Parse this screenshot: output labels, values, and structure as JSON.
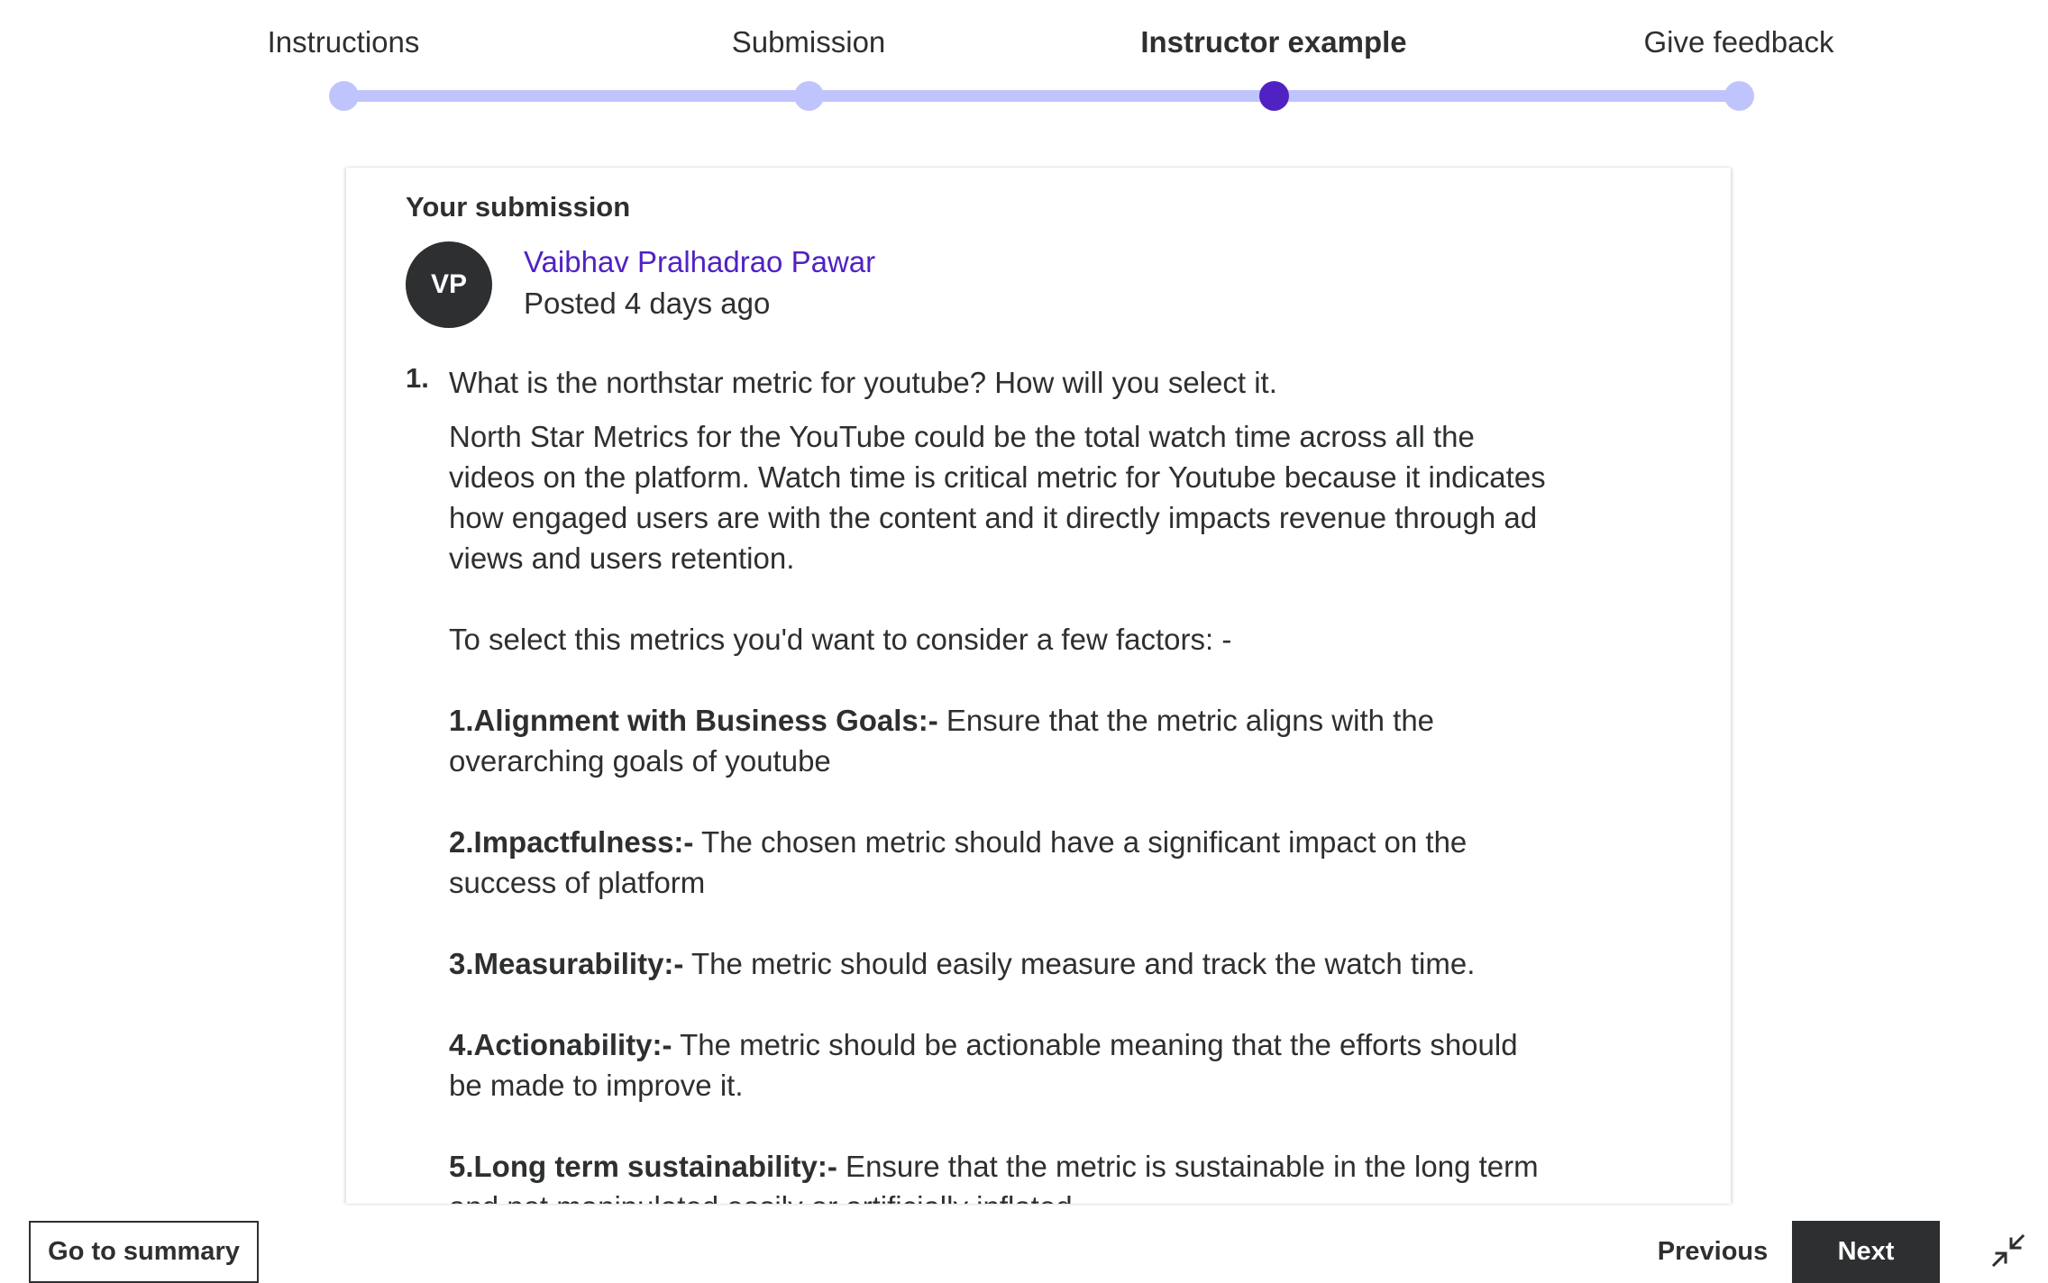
{
  "stepper": {
    "steps": [
      {
        "label": "Instructions",
        "state": "done"
      },
      {
        "label": "Submission",
        "state": "done"
      },
      {
        "label": "Instructor example",
        "state": "current"
      },
      {
        "label": "Give feedback",
        "state": "upcoming"
      }
    ],
    "active_index": 2
  },
  "submission": {
    "section_title": "Your submission",
    "author": {
      "initials": "VP",
      "name": "Vaibhav Pralhadrao Pawar",
      "posted": "Posted 4 days ago"
    },
    "question": {
      "number": "1.",
      "text": "What is the northstar metric for youtube? How will you select it."
    },
    "answer": {
      "intro": "North Star Metrics for the YouTube could be the total watch time across all the videos on the platform. Watch time is critical metric for Youtube because it indicates how engaged users are with the content and it directly impacts revenue through ad views and users retention.",
      "factors_intro": "To select this metrics you'd want to consider a few factors: -",
      "factors": [
        {
          "title": "1.Alignment with Business Goals:-",
          "text": "  Ensure that the metric aligns with the overarching goals of youtube"
        },
        {
          "title": "2.Impactfulness:-",
          "text": " The chosen metric should have a significant impact on the success of platform"
        },
        {
          "title": "3.Measurability:-",
          "text": " The metric should easily measure and track the watch time."
        },
        {
          "title": "4.Actionability:-",
          "text": " The metric should be actionable meaning that the efforts should be made to improve it."
        },
        {
          "title": "5.Long term sustainability:-",
          "text": " Ensure that the metric is sustainable in the long term and not manipulated easily or artificially inflated."
        }
      ]
    }
  },
  "footer": {
    "summary_label": "Go to summary",
    "previous_label": "Previous",
    "next_label": "Next",
    "collapse_icon": "collapse-arrows-icon"
  },
  "colors": {
    "accent": "#5022c3",
    "track": "#c0c4fc",
    "text": "#2d2f31",
    "button_dark": "#2d2f31"
  }
}
